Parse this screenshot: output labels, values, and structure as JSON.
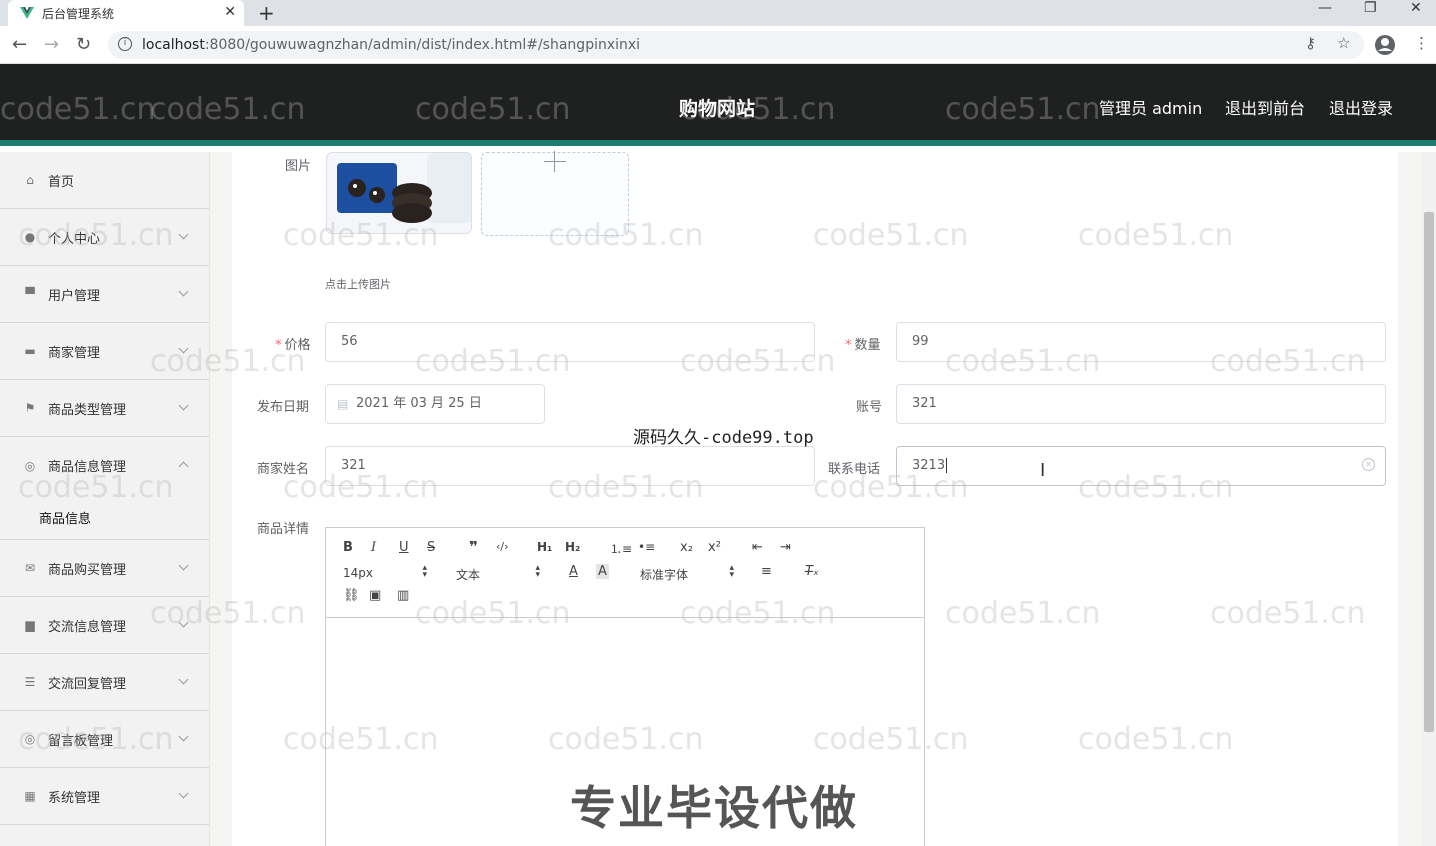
{
  "browser": {
    "tab_title": "后台管理系统",
    "url_host": "localhost",
    "url_rest": ":8080/gouwuwagnzhan/admin/dist/index.html#/shangpinxinxi"
  },
  "header": {
    "site_title": "购物网站",
    "admin_label": "管理员 admin",
    "to_front": "退出到前台",
    "logout": "退出登录"
  },
  "sidebar": {
    "items": [
      {
        "label": "首页",
        "icon": "home-icon"
      },
      {
        "label": "个人中心",
        "icon": "user-icon"
      },
      {
        "label": "用户管理",
        "icon": "users-icon"
      },
      {
        "label": "商家管理",
        "icon": "shop-icon"
      },
      {
        "label": "商品类型管理",
        "icon": "flag-icon"
      },
      {
        "label": "商品信息管理",
        "icon": "info-icon"
      },
      {
        "label": "商品购买管理",
        "icon": "mail-icon"
      },
      {
        "label": "交流信息管理",
        "icon": "chat-icon"
      },
      {
        "label": "交流回复管理",
        "icon": "sliders-icon"
      },
      {
        "label": "留言板管理",
        "icon": "message-icon"
      },
      {
        "label": "系统管理",
        "icon": "grid-icon"
      }
    ],
    "sub_active": "商品信息"
  },
  "form": {
    "image_label": "图片",
    "upload_tip": "点击上传图片",
    "price_label": "价格",
    "price_value": "56",
    "qty_label": "数量",
    "qty_value": "99",
    "date_label": "发布日期",
    "date_value": "2021 年 03 月 25 日",
    "account_label": "账号",
    "account_value": "321",
    "merchant_name_label": "商家姓名",
    "merchant_name_value": "321",
    "phone_label": "联系电话",
    "phone_value": "3213",
    "detail_label": "商品详情"
  },
  "editor": {
    "font_size": "14px",
    "text_type": "文本",
    "font_family": "标准字体"
  },
  "overlays": {
    "watermark": "code51.cn",
    "source_note": "源码久久-code99.top",
    "promo": "专业毕设代做"
  }
}
